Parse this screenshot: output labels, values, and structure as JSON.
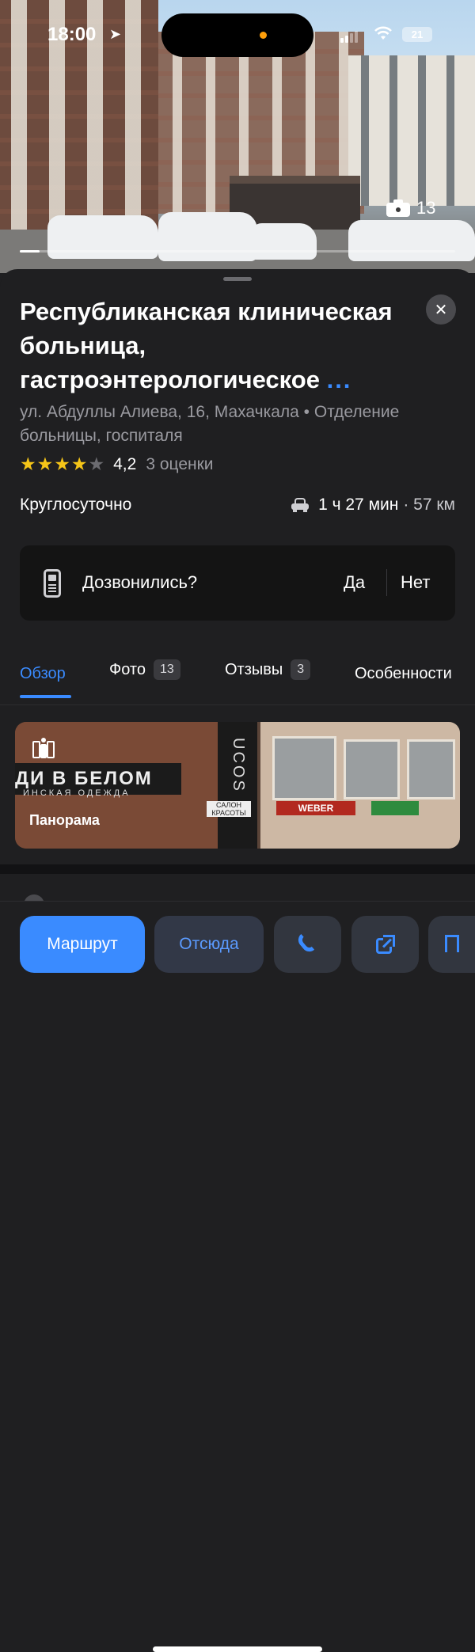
{
  "status_bar": {
    "time": "18:00",
    "battery": "21"
  },
  "photo": {
    "count": "13"
  },
  "place": {
    "title": "Республиканская клиническая больница, гастроэнтерологическое",
    "title_more": "...",
    "address": "ул. Абдуллы Алиева, 16, Махачкала • Отделение больницы, госпиталя",
    "rating_value": "4,2",
    "rating_count": "3 оценки",
    "rating_stars": 4,
    "hours": "Круглосуточно",
    "route_time": "1 ч 27 мин",
    "route_dist": "· 57 км"
  },
  "call_card": {
    "question": "Дозвонились?",
    "yes": "Да",
    "no": "Нет"
  },
  "tabs": [
    {
      "label": "Обзор",
      "badge": ""
    },
    {
      "label": "Фото",
      "badge": "13"
    },
    {
      "label": "Отзывы",
      "badge": "3"
    },
    {
      "label": "Особенности",
      "badge": ""
    }
  ],
  "panorama": {
    "label": "Панорама",
    "sign_text": "ДИ В БЕЛОМ",
    "sign_sub": "ИНСКАЯ ОДЕЖДА",
    "column_text": "UCOS",
    "salon_text": "САЛОН КРАСОТЫ",
    "shop_text": "WEBER"
  },
  "actions": {
    "route": "Маршрут",
    "from_here": "Отсюда"
  },
  "colors": {
    "accent": "#3a8bff",
    "star": "#f5c518",
    "background": "#1f1f21"
  }
}
